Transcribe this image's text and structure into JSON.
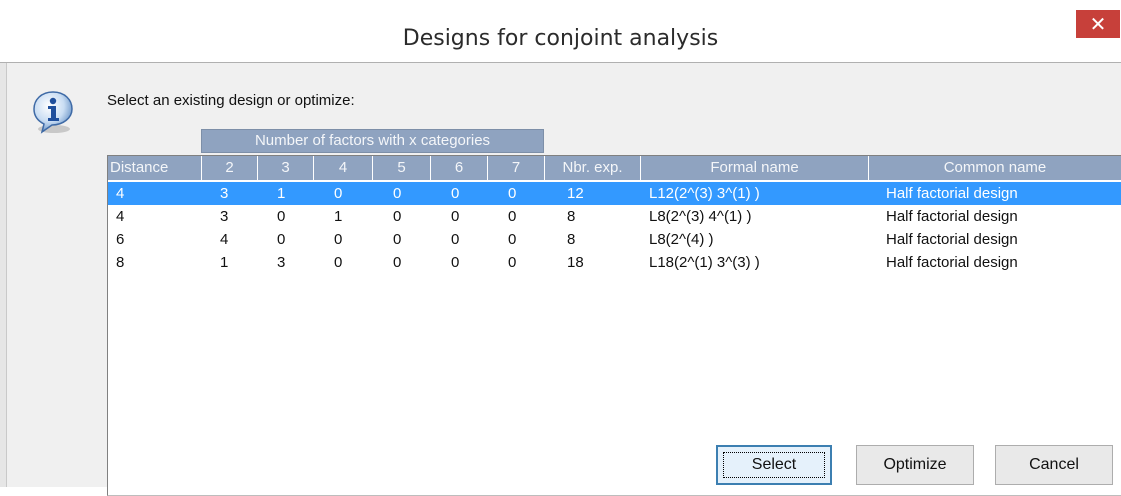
{
  "window": {
    "title": "Designs for conjoint analysis",
    "close_glyph": "✕"
  },
  "prompt": "Select an existing design or optimize:",
  "icon": "info-icon",
  "grid": {
    "group_header": "Number of factors with x categories",
    "columns": [
      "Distance",
      "2",
      "3",
      "4",
      "5",
      "6",
      "7",
      "Nbr. exp.",
      "Formal name",
      "Common name"
    ],
    "rows": [
      [
        "4",
        "3",
        "1",
        "0",
        "0",
        "0",
        "0",
        "12",
        "L12(2^(3) 3^(1) )",
        "Half factorial design"
      ],
      [
        "4",
        "3",
        "0",
        "1",
        "0",
        "0",
        "0",
        "8",
        "L8(2^(3) 4^(1) )",
        "Half factorial design"
      ],
      [
        "6",
        "4",
        "0",
        "0",
        "0",
        "0",
        "0",
        "8",
        "L8(2^(4) )",
        "Half factorial design"
      ],
      [
        "8",
        "1",
        "3",
        "0",
        "0",
        "0",
        "0",
        "18",
        "L18(2^(1) 3^(3) )",
        "Half factorial design"
      ]
    ],
    "selected_row": 0
  },
  "buttons": {
    "select": "Select",
    "optimize": "Optimize",
    "cancel": "Cancel"
  },
  "colors": {
    "header_bg": "#8fa3c0",
    "selection": "#3399ff",
    "close_bg": "#c7403a"
  }
}
